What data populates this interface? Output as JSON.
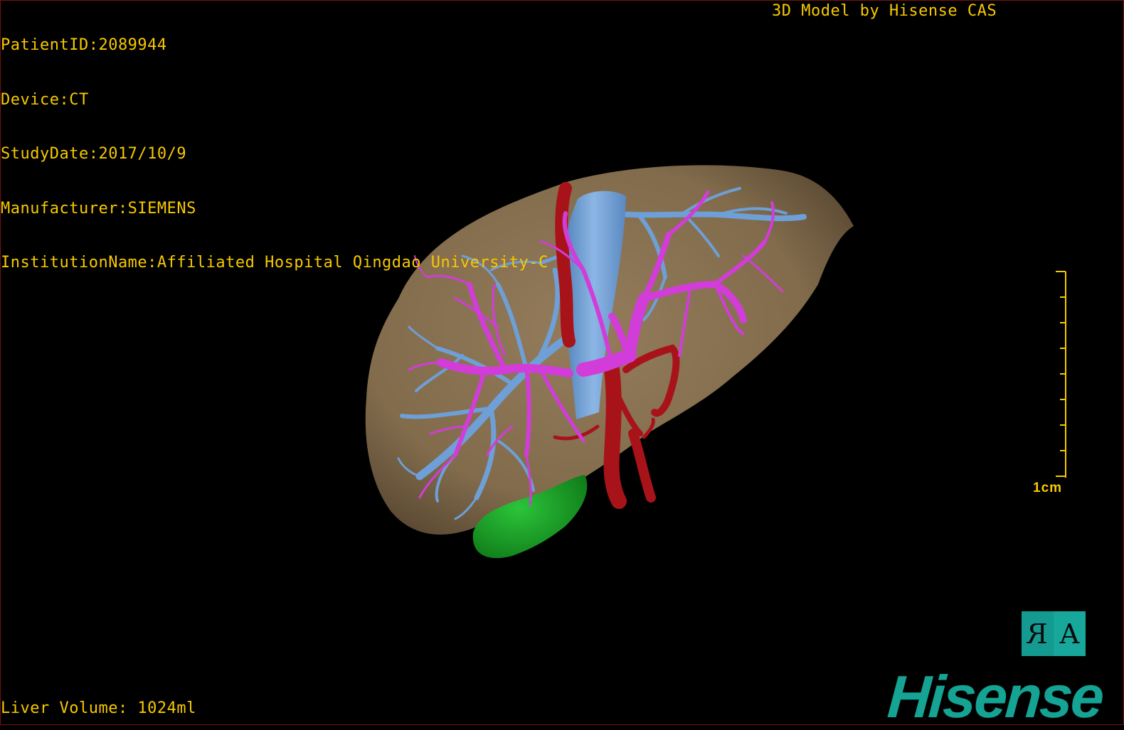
{
  "overlay": {
    "patient_id": "PatientID:2089944",
    "device": "Device:CT",
    "study_date": "StudyDate:2017/10/9",
    "manufacturer": "Manufacturer:SIEMENS",
    "institution": "InstitutionName:Affiliated Hospital Qingdao University-C",
    "model_credit": "3D Model by Hisense CAS",
    "liver_volume": "Liver Volume: 1024ml"
  },
  "scale_bar": {
    "label": "1cm"
  },
  "orientation_button": {
    "left_glyph": "R",
    "right_glyph": "A"
  },
  "logo": {
    "text": "Hisense"
  },
  "model": {
    "structures": [
      "liver",
      "portal-vein",
      "hepatic-vein",
      "hepatic-artery",
      "inferior-vena-cava",
      "gallbladder"
    ],
    "colors": {
      "background": "#000000",
      "text": "#f7c900",
      "liver": "#8a7253",
      "portal_vein": "#d23cd8",
      "hepatic_vein": "#6e9fd6",
      "artery": "#a8131a",
      "gallbladder": "#18a020",
      "brand": "#15a393"
    }
  }
}
